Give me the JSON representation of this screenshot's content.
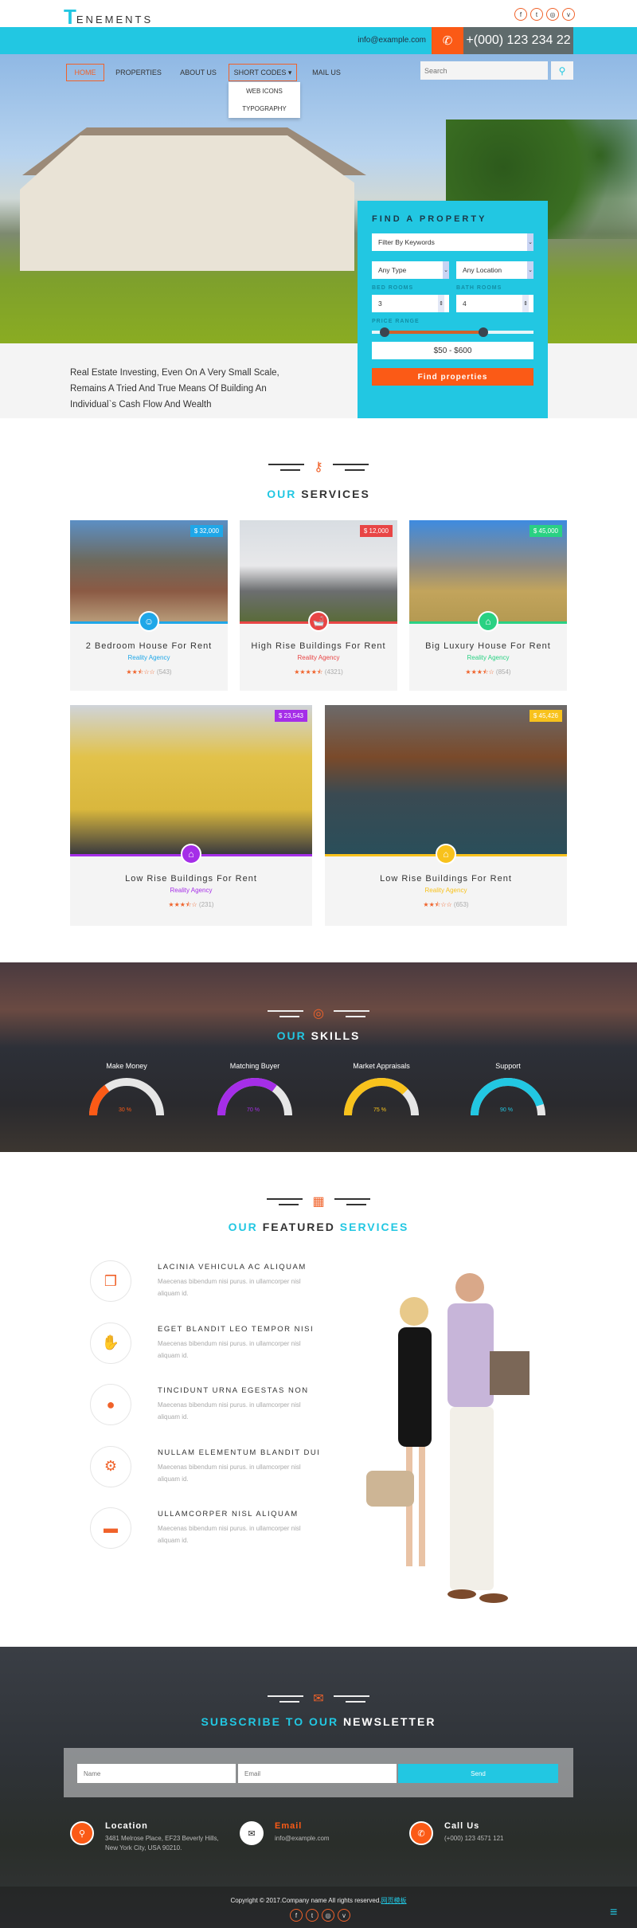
{
  "header": {
    "logo_letter": "T",
    "logo_rest": "ENEMENTS",
    "email": "info@example.com",
    "phone": "+(000) 123 234 22",
    "social": [
      {
        "icon": "facebook-icon",
        "glyph": "f"
      },
      {
        "icon": "twitter-icon",
        "glyph": "t"
      },
      {
        "icon": "instagram-icon",
        "glyph": "◎"
      },
      {
        "icon": "vimeo-icon",
        "glyph": "v"
      }
    ]
  },
  "nav": {
    "items": [
      "HOME",
      "PROPERTIES",
      "ABOUT US",
      "SHORT CODES ▾",
      "MAIL US"
    ],
    "active": "HOME",
    "dropdown": [
      "WEB ICONS",
      "TYPOGRAPHY"
    ],
    "search_placeholder": "Search"
  },
  "hero": {
    "tagline": "Real Estate Investing, Even On A Very Small Scale, Remains A Tried And True Means Of Building An Individual`s Cash Flow And Wealth"
  },
  "finder": {
    "title": "FIND A PROPERTY",
    "keywords": "Filter By Keywords",
    "type": "Any Type",
    "location": "Any Location",
    "bed_label": "BED ROOMS",
    "bed_value": "3",
    "bath_label": "BATH ROOMS",
    "bath_value": "4",
    "price_label": "PRICE RANGE",
    "price_min": 50,
    "price_max": 600,
    "slider_min_pct": 8,
    "slider_max_pct": 69,
    "range_text": "$50 - $600",
    "button": "Find properties"
  },
  "services": {
    "title_accent": "OUR",
    "title": "SERVICES",
    "cards": [
      {
        "title": "2 Bedroom House For Rent",
        "agency": "Reality Agency",
        "price": "$ 32,000",
        "color": "#1fa7e8",
        "icon": "user-icon",
        "glyph": "☺",
        "rating": 2.5,
        "reviews": "(543)"
      },
      {
        "title": "High Rise Buildings For Rent",
        "agency": "Reality Agency",
        "price": "$ 12,000",
        "color": "#e84545",
        "icon": "bath-icon",
        "glyph": "🛁",
        "rating": 4.5,
        "reviews": "(4321)"
      },
      {
        "title": "Big Luxury House For Rent",
        "agency": "Reality Agency",
        "price": "$ 45,000",
        "color": "#2ad183",
        "icon": "home-icon",
        "glyph": "⌂",
        "rating": 3.5,
        "reviews": "(854)"
      },
      {
        "title": "Low Rise Buildings For Rent",
        "agency": "Reality Agency",
        "price": "$ 23,543",
        "color": "#a52ee8",
        "icon": "home-icon",
        "glyph": "⌂",
        "rating": 3.5,
        "reviews": "(231)"
      },
      {
        "title": "Low Rise Buildings For Rent",
        "agency": "Reality Agency",
        "price": "$ 45,426",
        "color": "#f8c21c",
        "icon": "home-icon",
        "glyph": "⌂",
        "rating": 2.5,
        "reviews": "(653)"
      }
    ]
  },
  "skills": {
    "title_accent": "OUR",
    "title": "SKILLS",
    "items": [
      {
        "label": "Make Money",
        "percent": 30,
        "text": "30 %",
        "color": "#fb5a16"
      },
      {
        "label": "Matching Buyer",
        "percent": 70,
        "text": "70 %",
        "color": "#a52ee8"
      },
      {
        "label": "Market Appraisals",
        "percent": 75,
        "text": "75 %",
        "color": "#f8c21c"
      },
      {
        "label": "Support",
        "percent": 90,
        "text": "90 %",
        "color": "#22c7e2"
      }
    ]
  },
  "featured": {
    "title_accent": "OUR",
    "title": "FEATURED",
    "title_accent2": "SERVICES",
    "items": [
      {
        "title": "LACINIA VEHICULA AC ALIQUAM",
        "desc": "Maecenas bibendum nisi purus. in ullamcorper nisl aliquam id.",
        "icon": "cubes-icon",
        "glyph": "❒"
      },
      {
        "title": "EGET BLANDIT LEO TEMPOR NISI",
        "desc": "Maecenas bibendum nisi purus. in ullamcorper nisl aliquam id.",
        "icon": "handshake-icon",
        "glyph": "✋"
      },
      {
        "title": "TINCIDUNT URNA EGESTAS NON",
        "desc": "Maecenas bibendum nisi purus. in ullamcorper nisl aliquam id.",
        "icon": "globe-icon",
        "glyph": "●"
      },
      {
        "title": "NULLAM ELEMENTUM BLANDIT DUI",
        "desc": "Maecenas bibendum nisi purus. in ullamcorper nisl aliquam id.",
        "icon": "gear-icon",
        "glyph": "⚙"
      },
      {
        "title": "ULLAMCORPER NISL ALIQUAM",
        "desc": "Maecenas bibendum nisi purus. in ullamcorper nisl aliquam id.",
        "icon": "bed-icon",
        "glyph": "▬"
      }
    ]
  },
  "newsletter": {
    "title_accent": "SUBSCRIBE TO OUR",
    "title": "NEWSLETTER",
    "name_placeholder": "Name",
    "email_placeholder": "Email",
    "send": "Send"
  },
  "contact": [
    {
      "title": "Location",
      "text": "3481 Melrose Place, EF23 Beverly Hills, New York City, USA 90210.",
      "icon": "map-pin-icon",
      "glyph": "⚲"
    },
    {
      "title": "Email",
      "text": "info@example.com",
      "icon": "envelope-icon",
      "glyph": "✉"
    },
    {
      "title": "Call Us",
      "text": "(+000) 123 4571 121",
      "icon": "phone-icon",
      "glyph": "✆"
    }
  ],
  "footer": {
    "copyright": "Copyright © 2017.Company name All rights reserved.",
    "link": "网页模板"
  },
  "colors": {
    "accent": "#22c7e2",
    "orange": "#fb5a16"
  }
}
